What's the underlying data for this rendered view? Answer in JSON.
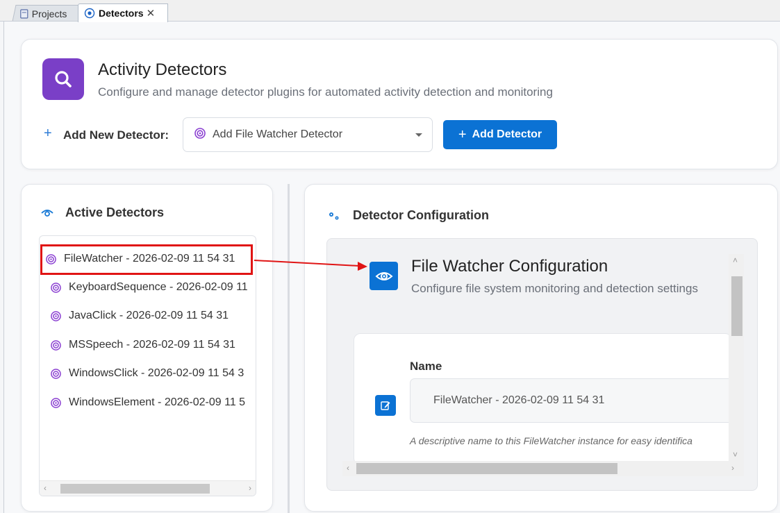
{
  "tabs": [
    {
      "label": "Projects",
      "icon": "document-icon",
      "active": false
    },
    {
      "label": "Detectors",
      "icon": "target-icon",
      "active": true,
      "close": "✕"
    }
  ],
  "header": {
    "title": "Activity Detectors",
    "subtitle": "Configure and manage detector plugins for automated activity detection and monitoring",
    "logo_icon": "search-icon",
    "accent": "#7a3fc7"
  },
  "add_detector": {
    "plus": "+",
    "label": "Add New Detector:",
    "selected": "Add File Watcher Detector",
    "button_plus": "+",
    "button_label": "Add Detector",
    "button_color": "#0b72d4"
  },
  "active_detectors": {
    "title": "Active Detectors",
    "items": [
      {
        "label": "FileWatcher - 2026-02-09 11 54 31",
        "selected": true
      },
      {
        "label": "KeyboardSequence - 2026-02-09 11"
      },
      {
        "label": "JavaClick - 2026-02-09 11 54 31"
      },
      {
        "label": "MSSpeech - 2026-02-09 11 54 31"
      },
      {
        "label": "WindowsClick - 2026-02-09 11 54 3"
      },
      {
        "label": "WindowsElement - 2026-02-09 11 5"
      }
    ]
  },
  "config": {
    "title": "Detector Configuration",
    "panel_title": "File Watcher Configuration",
    "panel_subtitle": "Configure file system monitoring and detection settings",
    "name_label": "Name",
    "name_value": "FileWatcher - 2026-02-09 11 54 31",
    "name_hint": "A descriptive name to this FileWatcher instance for easy identifica"
  },
  "annotation_color": "#e01414"
}
